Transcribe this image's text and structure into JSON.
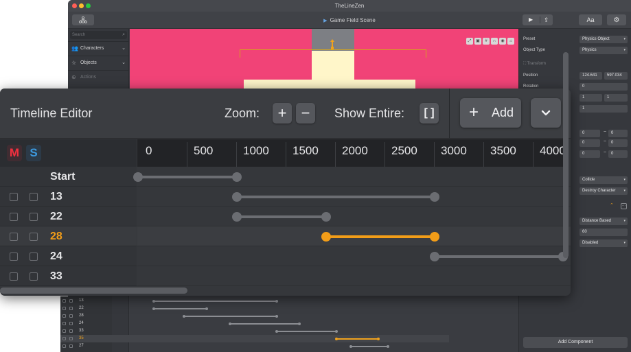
{
  "app": {
    "window_title": "TheLineZen",
    "scene_title": "Game Field Scene",
    "font_button_label": "Aa"
  },
  "left_panel": {
    "search_placeholder": "Search",
    "items": [
      {
        "label": "Characters",
        "icon": "people-icon"
      },
      {
        "label": "Objects",
        "icon": "star-icon"
      },
      {
        "label": "Actions",
        "icon": "circle-plus-icon"
      }
    ]
  },
  "right_panel": {
    "preset_label": "Preset",
    "preset_value": "Physics Object",
    "object_type_label": "Object Type",
    "object_type_value": "Physics",
    "transform_section": "Transform",
    "position_label": "Position",
    "position_x": "124.641",
    "position_y": "597.034",
    "rotation_label": "Rotation",
    "rotation_value": "0",
    "scale_a": "1",
    "scale_b": "1",
    "extra_value": "1",
    "range_rows": [
      [
        "0",
        "0"
      ],
      [
        "0",
        "0"
      ],
      [
        "0",
        "0"
      ]
    ],
    "collide_value": "Collide",
    "destroy_value": "Destroy Character",
    "distance_value": "Distance Based",
    "number_value": "60",
    "disabled_value": "Disabled",
    "add_component_label": "Add Component"
  },
  "mini_timeline": {
    "rows": [
      {
        "label": "13",
        "active": false,
        "start": 350,
        "end": 3000
      },
      {
        "label": "22",
        "active": false,
        "start": 350,
        "end": 1500
      },
      {
        "label": "28",
        "active": false,
        "start": 1000,
        "end": 3000
      },
      {
        "label": "24",
        "active": false,
        "start": 2000,
        "end": 3500
      },
      {
        "label": "33",
        "active": false,
        "start": 3000,
        "end": 4300
      },
      {
        "label": "35",
        "active": true,
        "start": 4300,
        "end": 5200
      },
      {
        "label": "27",
        "active": false,
        "start": 4600,
        "end": 5400
      }
    ]
  },
  "timeline_editor": {
    "title": "Timeline Editor",
    "zoom_label": "Zoom:",
    "zoom_in_glyph": "+",
    "zoom_out_glyph": "−",
    "show_entire_label": "Show Entire:",
    "show_entire_glyph": "[ ]",
    "add_label": "Add",
    "add_glyph": "+",
    "mute_label": "M",
    "solo_label": "S",
    "colors": {
      "mute": "#f2303f",
      "solo": "#3d9ae0",
      "active": "#f29d18",
      "track": "#6b6d72"
    },
    "ruler_ticks": [
      "0",
      "500",
      "1000",
      "1500",
      "2000",
      "2500",
      "3000",
      "3500",
      "4000"
    ],
    "rows": [
      {
        "label": "Start",
        "checkboxes": false,
        "active": false,
        "start": 0,
        "end": 1000
      },
      {
        "label": "13",
        "checkboxes": true,
        "active": false,
        "start": 1000,
        "end": 3000
      },
      {
        "label": "22",
        "checkboxes": true,
        "active": false,
        "start": 1000,
        "end": 1900
      },
      {
        "label": "28",
        "checkboxes": true,
        "active": true,
        "start": 1900,
        "end": 3000
      },
      {
        "label": "24",
        "checkboxes": true,
        "active": false,
        "start": 3000,
        "end": 4300
      },
      {
        "label": "33",
        "checkboxes": true,
        "active": false,
        "start": null,
        "end": null
      }
    ]
  }
}
